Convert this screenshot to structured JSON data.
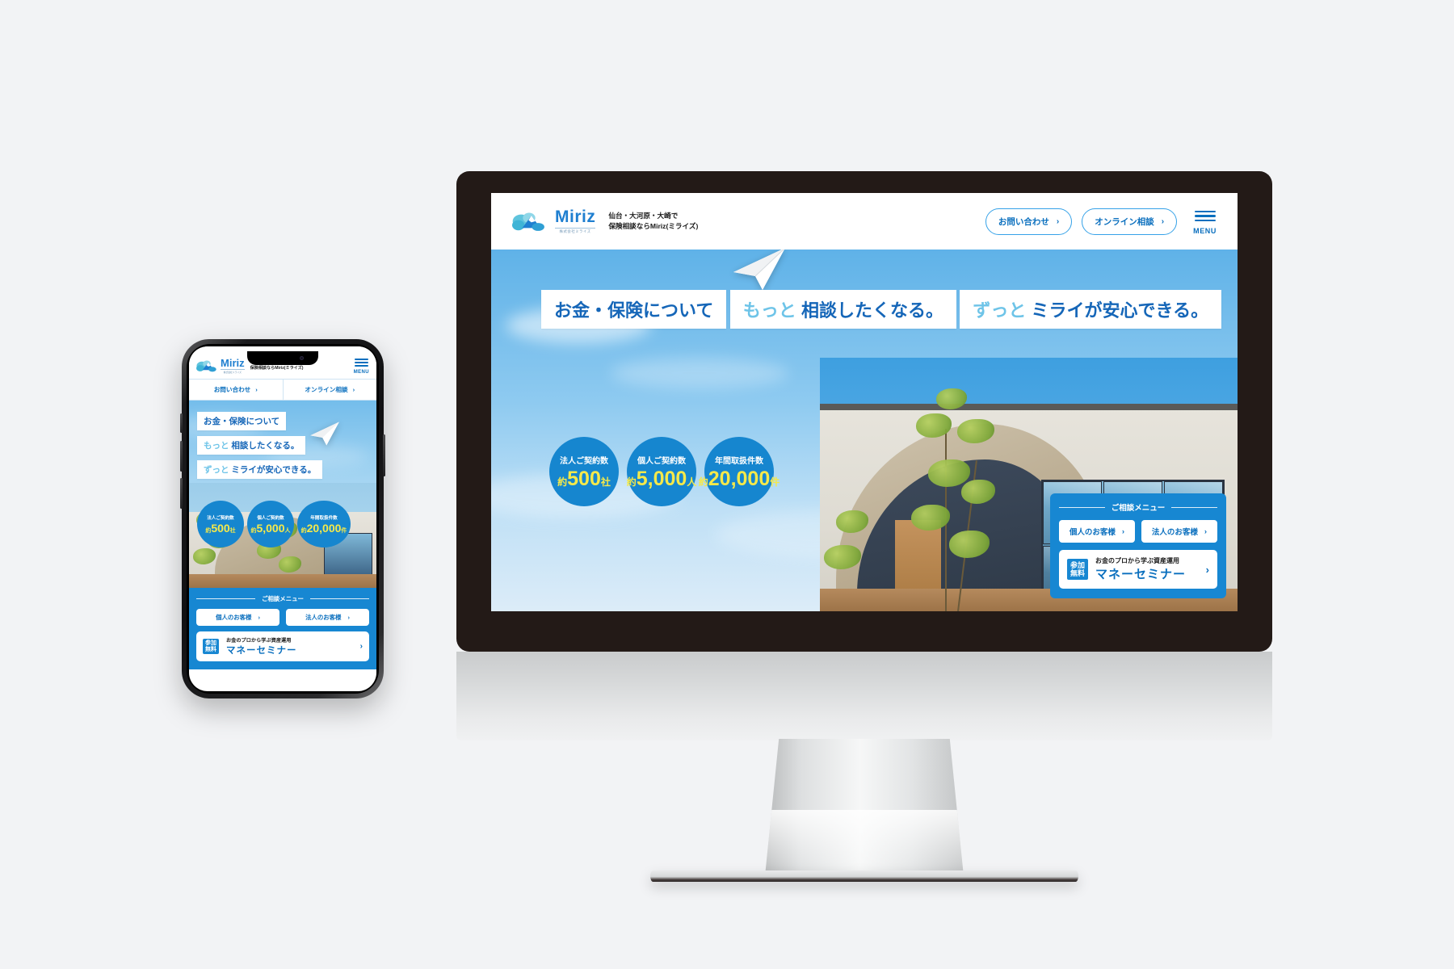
{
  "site": {
    "brand": {
      "name": "Miriz",
      "logo_icon": "cloud-mountain-logo-icon",
      "under_logo": "株式会社ミライズ",
      "tagline_line1": "仙台・大河原・大崎で",
      "tagline_line2": "保険相談ならMiriz(ミライズ)"
    },
    "header": {
      "contact_label": "お問い合わせ",
      "online_label": "オンライン相談",
      "menu_label": "MENU",
      "chevron": "›",
      "menu_icon": "hamburger-menu-icon"
    },
    "hero": {
      "copy_line1": "お金・保険について",
      "copy_line2_accent": "もっと",
      "copy_line2_main": "相談したくなる。",
      "copy_line3_accent": "ずっと",
      "copy_line3_main": "ミライが安心できる。",
      "paper_plane_icon": "paper-plane-icon",
      "building_photo": "architecture-building-photo"
    },
    "stats": [
      {
        "label": "法人ご契約数",
        "prefix": "約",
        "value": "500",
        "unit": "社"
      },
      {
        "label": "個人ご契約数",
        "prefix": "約",
        "value": "5,000",
        "unit": "人"
      },
      {
        "label": "年間取扱件数",
        "prefix": "約",
        "value": "20,000",
        "unit": "件"
      }
    ],
    "consult": {
      "title": "ご相談メニュー",
      "buttons": [
        {
          "label": "個人のお客様",
          "chevron": "›"
        },
        {
          "label": "法人のお客様",
          "chevron": "›"
        }
      ],
      "seminar": {
        "badge_line1": "参加",
        "badge_line2": "無料",
        "small": "お金のプロから学ぶ資産運用",
        "big": "マネーセミナー",
        "chevron": "›"
      }
    }
  },
  "colors": {
    "brand_blue": "#1787d2",
    "link_blue": "#0a6fbe",
    "accent_cyan": "#6ec4e8",
    "stat_yellow": "#f5e94a",
    "bezel": "#231a17",
    "page_bg": "#f2f3f5"
  },
  "devices": {
    "desktop_label": "desktop-monitor-mockup",
    "phone_label": "smartphone-mockup"
  }
}
